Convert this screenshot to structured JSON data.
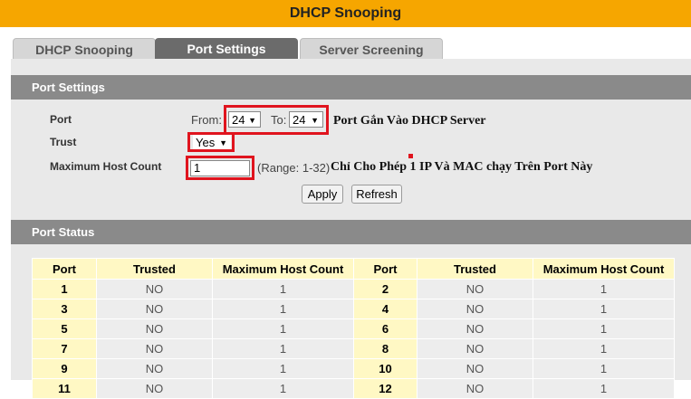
{
  "header": {
    "title": "DHCP Snooping"
  },
  "tabs": [
    {
      "label": "DHCP Snooping",
      "active": false
    },
    {
      "label": "Port Settings",
      "active": true
    },
    {
      "label": "Server Screening",
      "active": false
    }
  ],
  "port_settings": {
    "section_title": "Port Settings",
    "port_label": "Port",
    "from_label": "From:",
    "from_value": "24",
    "to_label": "To:",
    "to_value": "24",
    "trust_label": "Trust",
    "trust_value": "Yes",
    "max_host_label": "Maximum Host Count",
    "max_host_value": "1",
    "range_text": "(Range: 1-32)",
    "apply_label": "Apply",
    "refresh_label": "Refresh"
  },
  "annotations": {
    "port_note": "Port Gắn Vào DHCP Server",
    "host_note": "Chỉ Cho Phép 1 IP Và MAC chạy Trên Port Này"
  },
  "port_status": {
    "section_title": "Port Status",
    "headers": [
      "Port",
      "Trusted",
      "Maximum Host Count",
      "Port",
      "Trusted",
      "Maximum Host Count"
    ],
    "rows": [
      [
        "1",
        "NO",
        "1",
        "2",
        "NO",
        "1"
      ],
      [
        "3",
        "NO",
        "1",
        "4",
        "NO",
        "1"
      ],
      [
        "5",
        "NO",
        "1",
        "6",
        "NO",
        "1"
      ],
      [
        "7",
        "NO",
        "1",
        "8",
        "NO",
        "1"
      ],
      [
        "9",
        "NO",
        "1",
        "10",
        "NO",
        "1"
      ],
      [
        "11",
        "NO",
        "1",
        "12",
        "NO",
        "1"
      ]
    ]
  },
  "colors": {
    "title_bar": "#f6a600",
    "section_bar": "#8a8a8a",
    "highlight": "#e0141e",
    "port_cell": "#fff8c4"
  }
}
